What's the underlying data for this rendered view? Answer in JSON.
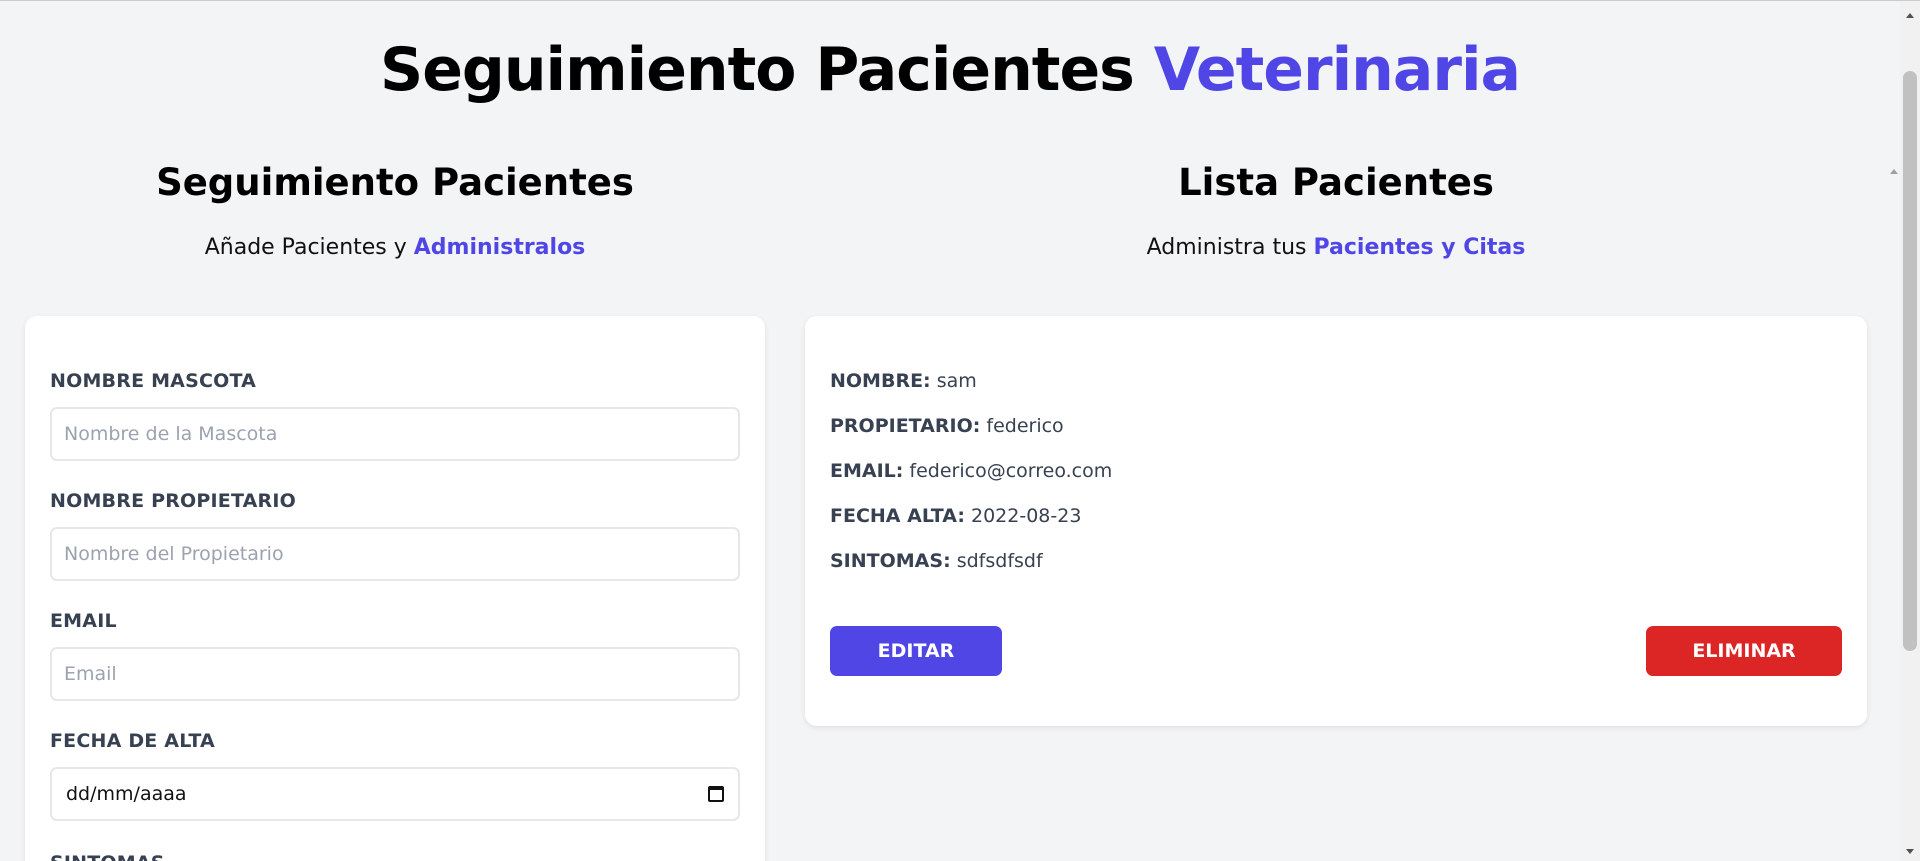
{
  "header": {
    "title_main": "Seguimiento Pacientes",
    "title_accent": "Veterinaria"
  },
  "form_section": {
    "heading": "Seguimiento Pacientes",
    "subtitle_text": "Añade Pacientes y",
    "subtitle_accent": "Administralos",
    "fields": [
      {
        "label": "NOMBRE MASCOTA",
        "placeholder": "Nombre de la Mascota",
        "value": ""
      },
      {
        "label": "NOMBRE PROPIETARIO",
        "placeholder": "Nombre del Propietario",
        "value": ""
      },
      {
        "label": "EMAIL",
        "placeholder": "Email",
        "value": ""
      },
      {
        "label": "FECHA DE ALTA",
        "placeholder": "dd/mm/aaaa",
        "value": ""
      },
      {
        "label": "SINTOMAS"
      }
    ]
  },
  "list_section": {
    "heading": "Lista Pacientes",
    "subtitle_text": "Administra tus",
    "subtitle_accent": "Pacientes y Citas",
    "patient": {
      "nombre_label": "NOMBRE:",
      "nombre": "sam",
      "propietario_label": "PROPIETARIO:",
      "propietario": "federico",
      "email_label": "EMAIL:",
      "email": "federico@correo.com",
      "fecha_label": "FECHA ALTA:",
      "fecha": "2022-08-23",
      "sintomas_label": "SINTOMAS:",
      "sintomas": "sdfsdfsdf",
      "edit_label": "Editar",
      "delete_label": "Eliminar"
    }
  },
  "colors": {
    "accent": "#4f46e5",
    "danger": "#dc2626",
    "background": "#f3f4f6"
  }
}
